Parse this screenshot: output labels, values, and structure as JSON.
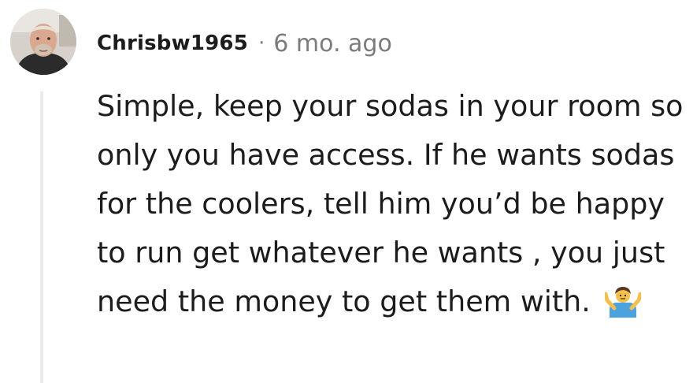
{
  "comment": {
    "author": "Chrisbw1965",
    "separator": "·",
    "timestamp": "6 mo. ago",
    "body": "Simple, keep your sodas in your room so only you have access. If he wants sodas for the coolers, tell him you’d be happy to run get whatever he wants , you just need the money to get them with.",
    "emoji_icon": "person-shrugging-icon"
  },
  "colors": {
    "text": "#1c1c1c",
    "meta": "#7c7c7c",
    "thread_line": "#ebebeb"
  }
}
